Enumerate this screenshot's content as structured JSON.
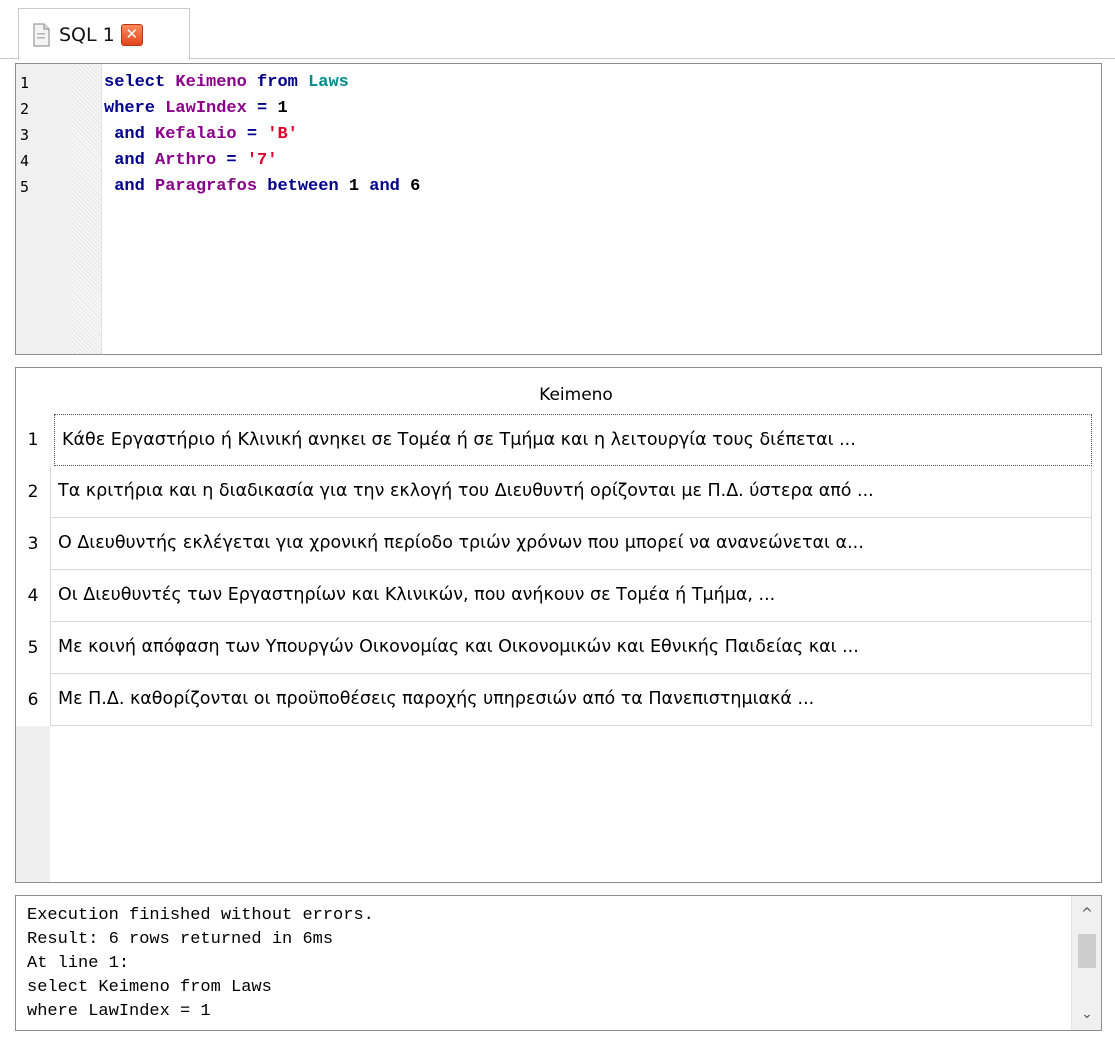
{
  "tab": {
    "label": "SQL 1",
    "icon": "document-icon",
    "close_symbol": "✕"
  },
  "editor": {
    "line_numbers": [
      "1",
      "2",
      "3",
      "4",
      "5"
    ],
    "lines": [
      [
        {
          "t": "select ",
          "c": "kw"
        },
        {
          "t": "Keimeno",
          "c": "id"
        },
        {
          "t": " from ",
          "c": "kw"
        },
        {
          "t": "Laws",
          "c": "tbl"
        }
      ],
      [
        {
          "t": "where ",
          "c": "kw"
        },
        {
          "t": "LawIndex",
          "c": "id"
        },
        {
          "t": " = ",
          "c": "kw"
        },
        {
          "t": "1",
          "c": "num"
        }
      ],
      [
        {
          "t": " and ",
          "c": "kw"
        },
        {
          "t": "Kefalaio",
          "c": "id"
        },
        {
          "t": " = ",
          "c": "kw"
        },
        {
          "t": "'B'",
          "c": "str"
        }
      ],
      [
        {
          "t": " and ",
          "c": "kw"
        },
        {
          "t": "Arthro",
          "c": "id"
        },
        {
          "t": " = ",
          "c": "kw"
        },
        {
          "t": "'7'",
          "c": "str"
        }
      ],
      [
        {
          "t": " and ",
          "c": "kw"
        },
        {
          "t": "Paragrafos",
          "c": "id"
        },
        {
          "t": " between ",
          "c": "kw"
        },
        {
          "t": "1",
          "c": "num"
        },
        {
          "t": " and ",
          "c": "kw"
        },
        {
          "t": "6",
          "c": "num"
        }
      ]
    ]
  },
  "results": {
    "column_header": "Keimeno",
    "rows": [
      {
        "num": "1",
        "text": "Κάθε Εργαστήριο ή Κλινική ανηκει σε Τομέα ή σε Τμήμα και η  λειτουργία τους διέπεται ..."
      },
      {
        "num": "2",
        "text": "Τα κριτήρια και η διαδικασία για την εκλογή του Διευθυντή ορίζονται με Π.Δ. ύστερα από ..."
      },
      {
        "num": "3",
        "text": "Ο Διευθυντής εκλέγεται για χρονική περίοδο τριών χρόνων που μπορεί  να ανανεώνεται α..."
      },
      {
        "num": "4",
        "text": "Οι Διευθυντές των Εργαστηρίων και  Κλινικών, που ανήκουν σε Τομέα ή Τμήμα, ..."
      },
      {
        "num": "5",
        "text": "Με κοινή απόφαση των Υπουργών Οικονομίας και Οικονομικών και Εθνικής Παιδείας και ..."
      },
      {
        "num": "6",
        "text": "Με Π.Δ. καθορίζονται οι προϋποθέσεις παροχής υπηρεσιών από τα  Πανεπιστημιακά ..."
      }
    ]
  },
  "messages": {
    "lines": [
      "Execution finished without errors.",
      "Result: 6 rows returned in 6ms",
      "At line 1:",
      "select Keimeno from Laws",
      "where LawIndex = 1"
    ],
    "scroll_up_symbol": "^",
    "scroll_down_symbol": "⌄"
  },
  "colors": {
    "keyword": "#00008b",
    "identifier": "#8b008b",
    "table": "#008b8b",
    "string": "#e0002a",
    "close_button": "#e0461c"
  }
}
